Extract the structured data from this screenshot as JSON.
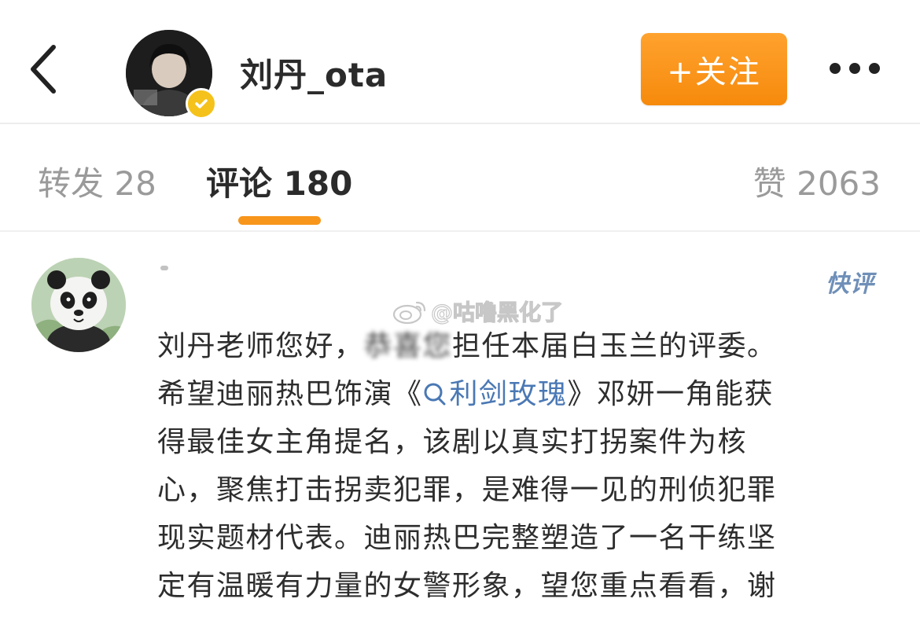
{
  "header": {
    "username": "刘丹_ota",
    "follow_label": "+关注"
  },
  "tabs": {
    "repost": "转发 28",
    "comment": "评论 180",
    "like": "赞 2063"
  },
  "comment": {
    "badge": "快评",
    "watermark": "@咕噜黑化了",
    "line1_a": "刘丹老师您好，",
    "line1_blur": "恭喜您",
    "line1_b": "担任本届白玉兰的评委。",
    "line2_a": "希望迪丽热巴饰演《",
    "line2_topic": "利剑玫瑰",
    "line2_b": "》邓妍一角能获",
    "line3": "得最佳女主角提名，该剧以真实打拐案件为核",
    "line4": "心，聚焦打击拐卖犯罪，是难得一见的刑侦犯罪",
    "line5": "现实题材代表。迪丽热巴完整塑造了一名干练坚",
    "line6": "定有温暖有力量的女警形象，望您重点看看，谢"
  },
  "colors": {
    "accent_orange": "#f68a0c",
    "link_blue": "#4a78b4",
    "verified_yellow": "#f5c21b"
  },
  "icons": [
    "back-arrow-icon",
    "verified-icon",
    "more-dots-icon",
    "search-icon",
    "weibo-logo-icon"
  ]
}
